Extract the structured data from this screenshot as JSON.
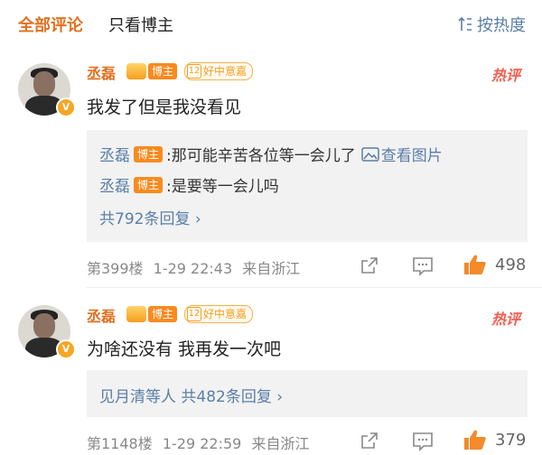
{
  "tabs": {
    "all": "全部评论",
    "blogger_only": "只看博主",
    "sort": "按热度"
  },
  "comments": [
    {
      "author": "丞磊",
      "tag_blogger": "博主",
      "tag_good": "好中意嘉",
      "level": "12",
      "hot": "热评",
      "text": "我发了但是我没看见",
      "replies": [
        {
          "name": "丞磊",
          "tag": "博主",
          "text": ":那可能辛苦各位等一会儿了",
          "view_pic": "查看图片"
        },
        {
          "name": "丞磊",
          "tag": "博主",
          "text": ":是要等一会儿吗"
        }
      ],
      "more": "共792条回复 ›",
      "floor": "第399楼",
      "time": "1-29 22:43",
      "location": "来自浙江",
      "likes": "498"
    },
    {
      "author": "丞磊",
      "tag_blogger": "博主",
      "tag_good": "好中意嘉",
      "level": "12",
      "hot": "热评",
      "text": "为啥还没有 我再发一次吧",
      "more": "见月清等人 共482条回复 ›",
      "floor": "第1148楼",
      "time": "1-29 22:59",
      "location": "来自浙江",
      "likes": "379"
    }
  ],
  "colors": {
    "accent": "#e27020",
    "link": "#5a7ea8",
    "hot": "#f25d4f",
    "like": "#f48a2a"
  }
}
